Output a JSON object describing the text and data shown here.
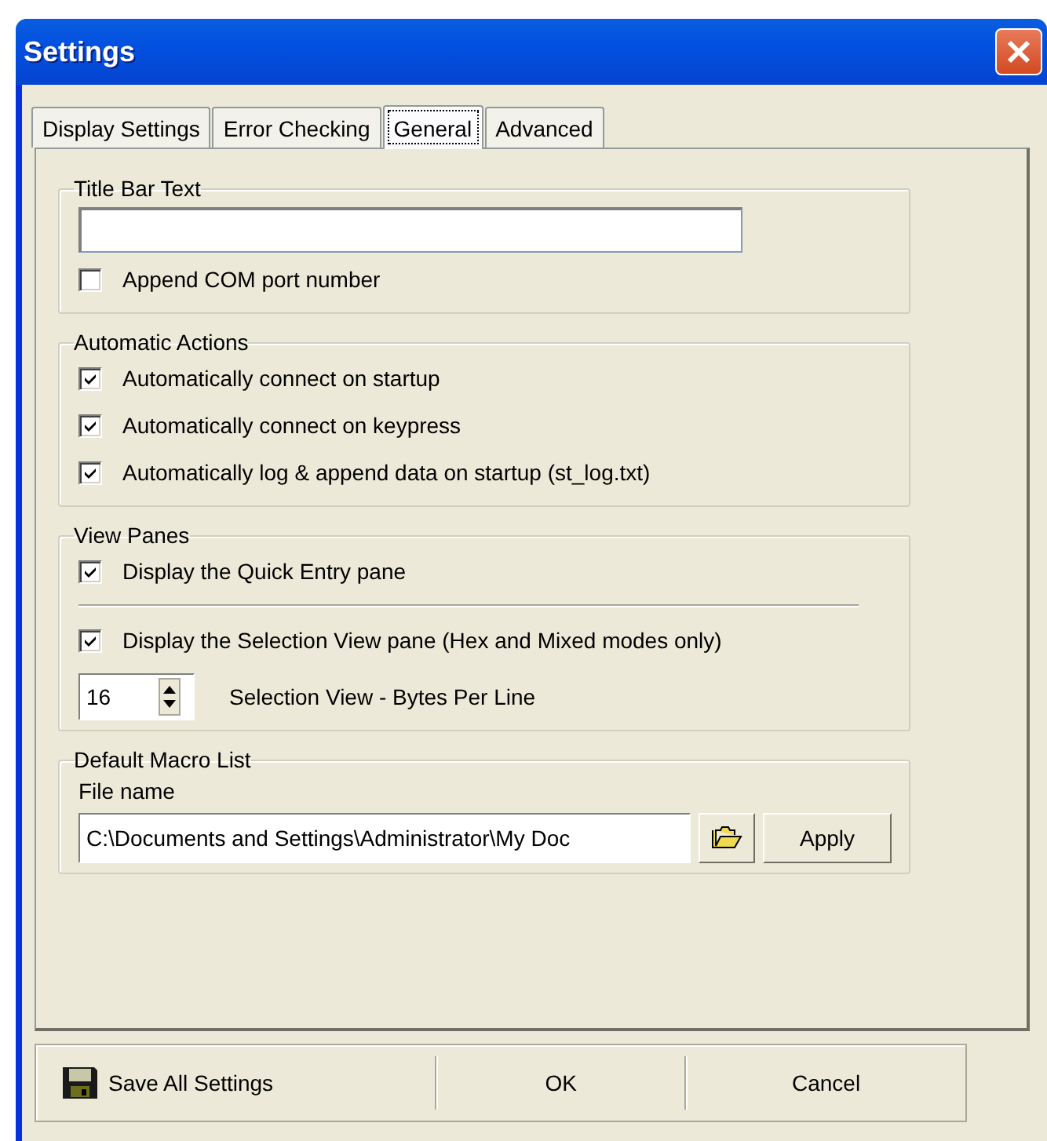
{
  "window": {
    "title": "Settings"
  },
  "tabs": [
    {
      "label": "Display Settings",
      "selected": false
    },
    {
      "label": "Error Checking",
      "selected": false
    },
    {
      "label": "General",
      "selected": true
    },
    {
      "label": "Advanced",
      "selected": false
    }
  ],
  "groups": [
    {
      "title": "Title Bar Text",
      "items": [
        {
          "kind": "text_field"
        },
        {
          "kind": "checkbox",
          "label": "Append COM port number",
          "checked": false
        }
      ]
    },
    {
      "title": "Automatic Actions",
      "items": [
        {
          "kind": "checkbox",
          "label": "Automatically connect on startup",
          "checked": true
        },
        {
          "kind": "checkbox",
          "label": "Automatically connect on keypress",
          "checked": true
        },
        {
          "kind": "checkbox",
          "label": "Automatically log & append data on startup (st_log.txt)",
          "checked": true
        }
      ]
    },
    {
      "title": "View Panes",
      "items": [
        {
          "kind": "checkbox",
          "label": "Display the Quick Entry pane",
          "checked": true
        },
        {
          "kind": "separator"
        },
        {
          "kind": "checkbox",
          "label": "Display the Selection View pane (Hex and Mixed modes only)",
          "checked": true
        },
        {
          "kind": "spinner",
          "number": "16",
          "label": "Selection View - Bytes Per Line"
        }
      ]
    },
    {
      "title": "Default Macro List",
      "items": [
        {
          "kind": "label",
          "text": "File name"
        },
        {
          "kind": "file_picker",
          "value": "C:\\Documents and Settings\\Administrator\\My Doc",
          "button": "Apply"
        }
      ]
    }
  ],
  "footer": {
    "buttons": [
      {
        "kind": "save",
        "label": "Save All Settings"
      },
      {
        "kind": "plain",
        "label": "OK"
      },
      {
        "kind": "plain",
        "label": "Cancel"
      }
    ]
  }
}
